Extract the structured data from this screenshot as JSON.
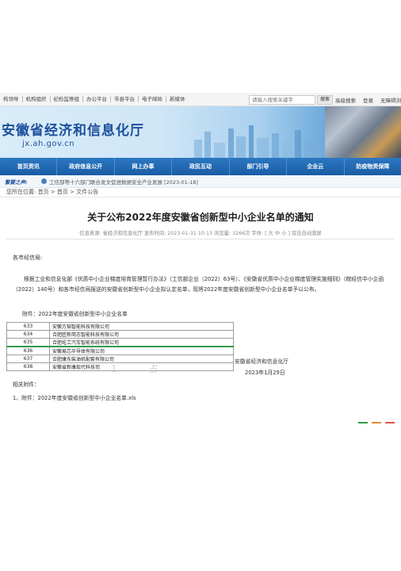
{
  "topbar": {
    "links": [
      "构领导",
      "机构组织",
      "纪检监察组",
      "办公平台",
      "市县平台",
      "电子邮局",
      "新媒体"
    ],
    "search_placeholder": "请输入搜索关键字",
    "search_button": "搜索",
    "right_links": [
      "高级搜索",
      "登录",
      "无障碍浏"
    ]
  },
  "banner": {
    "title": "安徽省经济和信息化厅",
    "domain": "jx.ah.gov.cn"
  },
  "nav": {
    "items": [
      "首页资讯",
      "政府信息公开",
      "网上办事",
      "政民互动",
      "部门引导",
      "企业云",
      "防疫物资保障"
    ]
  },
  "ticker": {
    "label": "繁要之声:",
    "text": "工信部等十六部门联合发文促进数据安全产业发展 [2023-01-18]"
  },
  "breadcrumb": {
    "text": "您所在位置: 首页 > 首页 > 文件公告"
  },
  "article": {
    "title": "关于公布2022年度安徽省创新型中小企业名单的通知",
    "meta": "信息来源: 省经济和信息化厅    发布时间: 2023-01-31 10:13    浏览量: 3266次    字体: [ 大 中 小 ]    双击自动滚屏",
    "salutation": "各市经信局:",
    "paragraph": "根据工业和信息化部《优质中小企业梯度培育管理暂行办法》（工信部企业〔2022〕63号）、《安徽省优质中小企业梯度管理实施细则》（皖经信中小企函〔2022〕140号）和各市经信局报送的安徽省创新型中小企业拟认定名单，现将2022年度安徽省创新型中小企业名单予以公布。",
    "attachment_label": "附件：2022年度安徽省创新型中小企业名单",
    "table": [
      {
        "num": "633",
        "name": "安徽方韬智能科技有限公司"
      },
      {
        "num": "634",
        "name": "合肥匠新简志智能科技有限公司"
      },
      {
        "num": "635",
        "name": "合肥屹工汽车智能系统有限公司"
      },
      {
        "num": "636",
        "name": "安徽易芯半导体有限公司"
      },
      {
        "num": "637",
        "name": "合肥康东柴油机配套有限公司"
      },
      {
        "num": "638",
        "name": "安徽省新康现代科技司"
      }
    ],
    "stamp_text": "1 占",
    "signature": "安徽省经济和信息化厅",
    "date": "2023年1月29日",
    "related_label": "相关附件：",
    "related_file": "1、附件：2022年度安徽省创新型中小企业名单.xls"
  },
  "colors": {
    "nav": "#1a5ca5",
    "title": "#1c4f9c",
    "share": [
      "#2f9c4a",
      "#e8893a",
      "#d9534f"
    ]
  }
}
